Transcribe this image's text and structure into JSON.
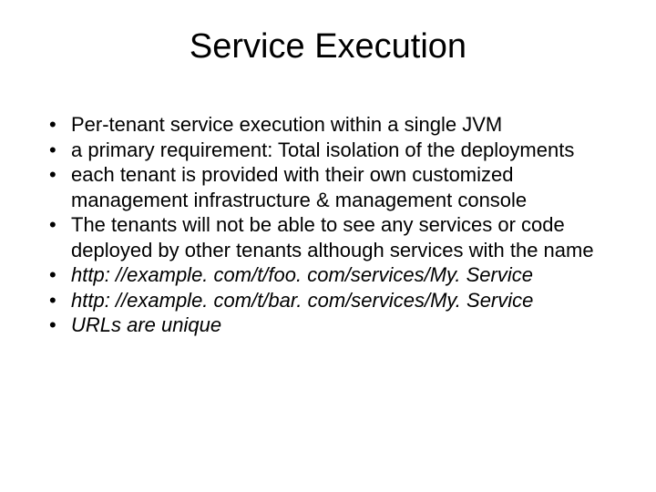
{
  "title": "Service Execution",
  "bullets": [
    {
      "text": "Per-tenant service execution within a single JVM",
      "italic": false
    },
    {
      "text": "a primary requirement: Total isolation of the deployments",
      "italic": false
    },
    {
      "text": "each tenant is provided with their own customized management infrastructure & management console",
      "italic": false
    },
    {
      "text": "The tenants will not be able to see any services or code deployed by other tenants although services with the name",
      "italic": false
    },
    {
      "text": "http: //example. com/t/foo. com/services/My. Service",
      "italic": true
    },
    {
      "text": "http: //example. com/t/bar. com/services/My. Service",
      "italic": true
    },
    {
      "text": "URLs  are unique",
      "italic": true
    }
  ]
}
